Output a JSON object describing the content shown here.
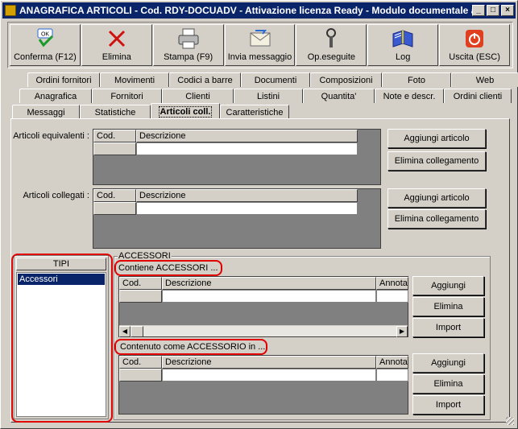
{
  "window": {
    "title": "ANAGRAFICA ARTICOLI - Cod. RDY-DOCUADV - Attivazione licenza Ready - Modulo documentale a...",
    "min_glyph": "_",
    "max_glyph": "□",
    "close_glyph": "×"
  },
  "toolbar": {
    "buttons": [
      {
        "label": "Conferma (F12)",
        "icon": "ok-check-icon"
      },
      {
        "label": "Elimina",
        "icon": "delete-x-icon"
      },
      {
        "label": "Stampa (F9)",
        "icon": "printer-icon"
      },
      {
        "label": "Invia messaggio",
        "icon": "envelope-icon"
      },
      {
        "label": "Op.eseguite",
        "icon": "wrench-icon"
      },
      {
        "label": "Log",
        "icon": "book-icon"
      },
      {
        "label": "Uscita (ESC)",
        "icon": "power-icon"
      }
    ],
    "ok_badge": "OK"
  },
  "tabs": {
    "row1": [
      "Ordini fornitori",
      "Movimenti",
      "Codici a barre",
      "Documenti",
      "Composizioni",
      "Foto",
      "Web"
    ],
    "row2": [
      "Anagrafica",
      "Fornitori",
      "Clienti",
      "Listini",
      "Quantita'",
      "Note e descr.",
      "Ordini clienti"
    ],
    "row3": [
      "Messaggi",
      "Statistiche",
      "Articoli coll.",
      "Caratteristiche"
    ],
    "active": "Articoli coll."
  },
  "equivalenti": {
    "label": "Articoli equivalenti :",
    "col_cod": "Cod.",
    "col_descrizione": "Descrizione",
    "btn_add": "Aggiungi articolo",
    "btn_remove": "Elimina collegamento"
  },
  "collegati": {
    "label": "Articoli collegati :",
    "col_cod": "Cod.",
    "col_descrizione": "Descrizione",
    "btn_add": "Aggiungi articolo",
    "btn_remove": "Elimina collegamento"
  },
  "tipi": {
    "header": "TIPI",
    "items": [
      "Accessori"
    ]
  },
  "accessori": {
    "group_label": "ACCESSORI",
    "contiene": {
      "label": "Contiene ACCESSORI ...",
      "col_cod": "Cod.",
      "col_descrizione": "Descrizione",
      "col_annota": "Annota",
      "btn_add": "Aggiungi",
      "btn_remove": "Elimina",
      "btn_import": "Import"
    },
    "contenuto": {
      "label": "Contenuto come ACCESSORIO in ...",
      "col_cod": "Cod.",
      "col_descrizione": "Descrizione",
      "col_annota": "Annota",
      "btn_add": "Aggiungi",
      "btn_remove": "Elimina",
      "btn_import": "Import"
    }
  },
  "colors": {
    "title_bg": "#0a246a",
    "face": "#d4d0c8",
    "highlight_red": "#e00000",
    "selection": "#0a246a"
  }
}
